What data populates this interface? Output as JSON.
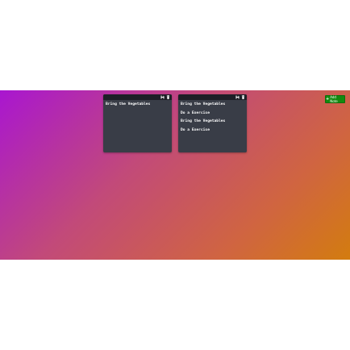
{
  "toolbar": {
    "add_note_label": "Add Note"
  },
  "notes": [
    {
      "lines": [
        "Bring the Vegetables"
      ]
    },
    {
      "lines": [
        "Bring the Vegetables",
        "Do a Exercise",
        "Bring the Vegetables",
        "Do a Exercise"
      ]
    }
  ],
  "colors": {
    "note_bg": "#393d47",
    "note_header": "#1d1f26",
    "add_button": "#138a0f"
  },
  "icons": [
    "save-icon",
    "trash-icon",
    "plus-icon"
  ]
}
